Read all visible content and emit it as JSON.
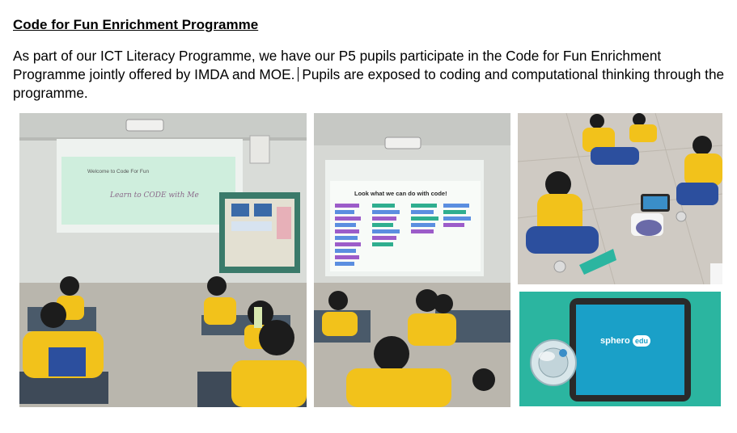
{
  "heading": "Code for Fun Enrichment Programme",
  "paragraph": {
    "part1": "As part of our ICT Literacy Programme, we have our P5 pupils participate in the Code for Fun Enrichment Programme jointly offered by IMDA and MOE.",
    "part2": "Pupils are exposed to coding and computational thinking through the programme."
  },
  "photos": {
    "photo1": {
      "screen_text": "Welcome to Code For Fun",
      "logo_text": "Learn to CODE with Me"
    },
    "photo2": {
      "screen_text": "Look what we can do with code!"
    },
    "photo4": {
      "brand_text": "sphero",
      "brand_suffix": "edu"
    }
  },
  "colors": {
    "uniform_yellow": "#f2c21b",
    "uniform_blue": "#2c4f9e",
    "sphero_teal": "#2bb5a0",
    "tablet_blue": "#1aa0c8"
  }
}
